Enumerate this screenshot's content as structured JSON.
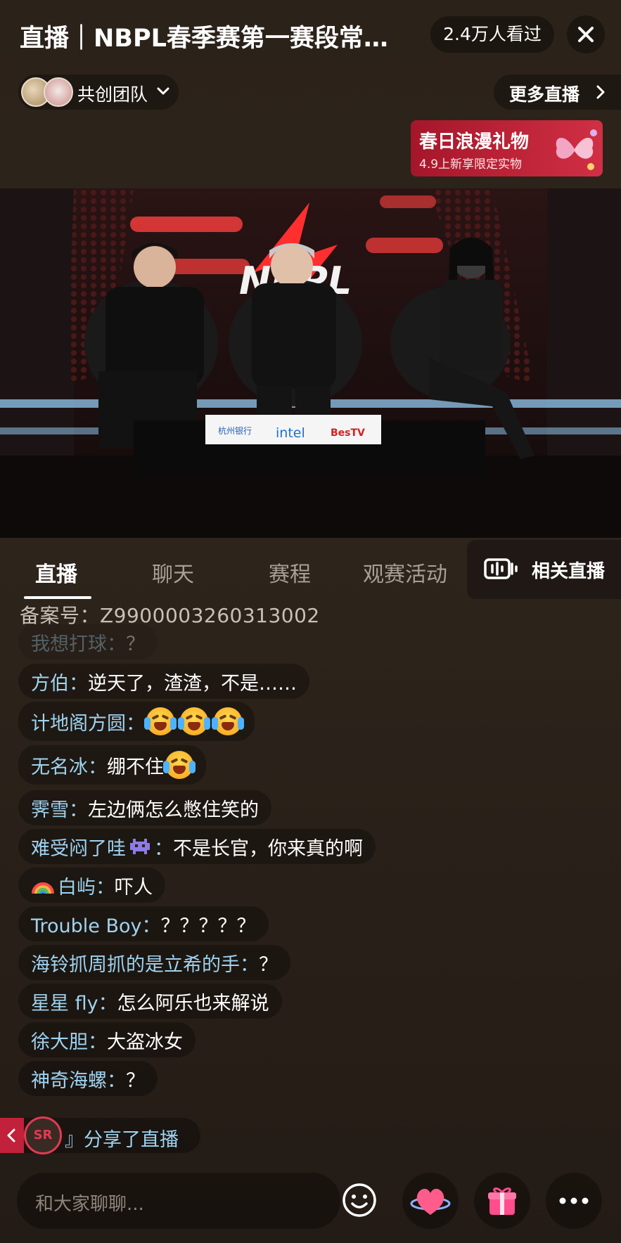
{
  "header": {
    "title": "直播｜NBPL春季赛第一赛段常…",
    "viewers": "2.4万人看过",
    "team_label": "共创团队",
    "more_live": "更多直播"
  },
  "banner": {
    "title": "春日浪漫礼物",
    "subtitle": "4.9上新享限定实物"
  },
  "video": {
    "stage_logo": "NBPL",
    "sponsors": [
      "杭州银行",
      "intel",
      "BesTV"
    ]
  },
  "tabs": [
    {
      "label": "直播",
      "active": true
    },
    {
      "label": "聊天",
      "active": false
    },
    {
      "label": "赛程",
      "active": false
    },
    {
      "label": "观赛活动",
      "active": false
    }
  ],
  "related_live": "相关直播",
  "record_no": "备案号：Z9900003260313002",
  "chat": [
    {
      "name": "我想打球：",
      "text": "？",
      "faded": true
    },
    {
      "name": "方伯：",
      "text": "逆天了，渣渣，不是……"
    },
    {
      "name": "计地阁方圆：",
      "text": "",
      "emojis": 3
    },
    {
      "name": "无名冰：",
      "text": "绷不住",
      "emojis": 1
    },
    {
      "name": "霁雪：",
      "text": "左边俩怎么憋住笑的"
    },
    {
      "name": "难受闷了哇",
      "name_suffix": "：",
      "text": "不是长官，你来真的啊",
      "icon": "alien-icon"
    },
    {
      "name": "白屿：",
      "text": "吓人",
      "icon": "rainbow-icon"
    },
    {
      "name": "Trouble Boy：",
      "text": "？？？？？"
    },
    {
      "name": "海铃抓周抓的是立希的手：",
      "text": "？"
    },
    {
      "name": "星星 fly：",
      "text": "怎么阿乐也来解说"
    },
    {
      "name": "徐大胆：",
      "text": "大盗冰女"
    },
    {
      "name": "神奇海螺：",
      "text": "？"
    }
  ],
  "share": {
    "avatar_text": "SR",
    "text": "』分享了直播"
  },
  "bottom": {
    "placeholder": "和大家聊聊..."
  },
  "colors": {
    "accent_red": "#d12f44",
    "name_blue": "#9fd3f0",
    "background": "#2b221a"
  }
}
